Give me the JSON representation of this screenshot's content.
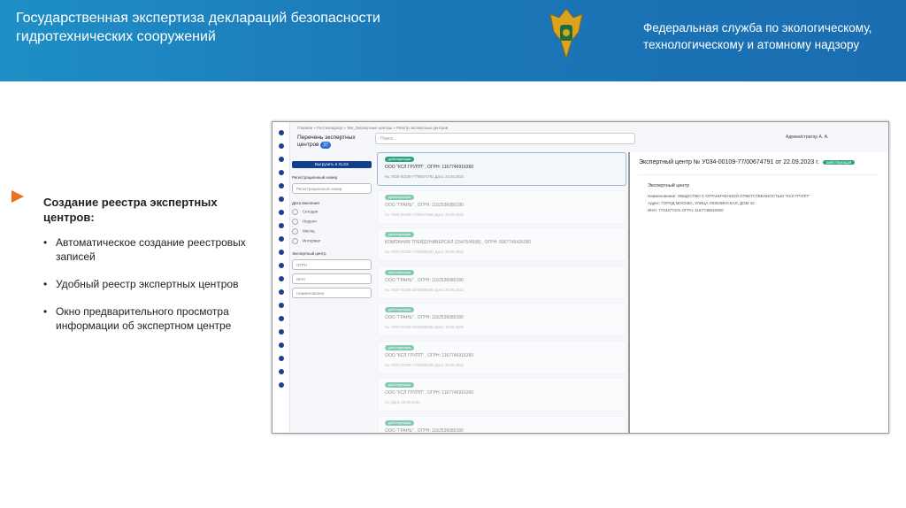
{
  "banner": {
    "title": "Государственная экспертиза деклараций безопасности гидротехнических сооружений",
    "org": "Федеральная служба по экологическому, технологическому и атомному надзору"
  },
  "slide": {
    "heading": "Создание реестра экспертных центров:",
    "bullets": [
      "Автоматическое создание реестровых записей",
      "Удобный реестр экспертных центров",
      "Окно предварительного просмотра информации об экспертном центре"
    ]
  },
  "app": {
    "breadcrumbs": "Главная » Ростехнадзор » ЭМ_Экспертные центры » Реестр экспертных центров",
    "page_title": "Перечень экспертных центров",
    "count": "37",
    "search_placeholder": "Поиск...",
    "user": "Администратор А. А.",
    "export_label": "Выгрузить в XLSX",
    "reg_label": "Регистрационный номер",
    "reg_placeholder": "Регистрационный номер",
    "date_label": "Дата внесения",
    "date_options": [
      "Сегодня",
      "Неделя",
      "Месяц",
      "Интервал"
    ],
    "center_label": "Экспертный центр",
    "ogrn_placeholder": "ОГРН",
    "inn_placeholder": "ИНН",
    "name_placeholder": "Наименование",
    "cards": [
      {
        "status": "действующая",
        "name": "ООО \"КСЛ ГРУПП\" , ОГРН: 1167746916360",
        "meta": "№: У034-00109-77/00674791  Дата: 22.09.2023"
      },
      {
        "status": "действующая",
        "name": "ООО \"ГРАНЬ\" , ОГРН: 1162536080180",
        "meta": "№: У034-00109-77/00674494  Дата: 22.09.2023"
      },
      {
        "status": "действующая",
        "name": "КОМПАНИЯ ТРЕЙДУНИВЕРСАЛ (15476/4598) , ОГРН: 5067746426360",
        "meta": "№: У037-00109-77/00608067  Дата: 26.06.2023"
      },
      {
        "status": "действующая",
        "name": "ООО \"ГРАНЬ\" , ОГРН: 1162536080180",
        "meta": "№: У037-00109-25/00608094  Дата: 25.06.2023"
      },
      {
        "status": "действующая",
        "name": "ООО \"ГРАНЬ\" , ОГРН: 1162536080180",
        "meta": "№: У037-00109-25/00608094  Дата: 15.06.2023"
      },
      {
        "status": "действующая",
        "name": "ООО \"КСЛ ГРУПП\" , ОГРН: 1167746916360",
        "meta": "№: У037-00109-77/00608090  Дата: 25.06.2023"
      },
      {
        "status": "действующая",
        "name": "ООО \"КСЛ ГРУПП\" , ОГРН: 1167746916360",
        "meta": "№:  Дата: 15.06.2023"
      },
      {
        "status": "действующая",
        "name": "ООО \"ГРАНЬ\" , ОГРН: 1162536080180",
        "meta": ""
      }
    ],
    "detail": {
      "title": "Экспертный центр  № У034-00109-77/00674791 от 22.09.2023 г.",
      "status": "действующая",
      "section": "Экспертный центр",
      "name_label": "Наименование:",
      "name": "ОБЩЕСТВО С ОГРАНИЧЕННОЙ ОТВЕТСТВЕННОСТЬЮ \"КСЛ ГРУПП\"",
      "addr_label": "Адрес:",
      "addr": "ГОРОД МОСКВА, УЛИЦА ЛЮБЛИНСКАЯ, ДОМ 42",
      "inn_label": "ИНН:",
      "inn": "7723477101",
      "ogrn_label": "ОГРН:",
      "ogrn": "1167746916360"
    }
  },
  "colors": {
    "banner": "#1b78b8",
    "accent_arrow": "#e8731c",
    "badge": "#2aa57a",
    "export": "#123f8c"
  }
}
